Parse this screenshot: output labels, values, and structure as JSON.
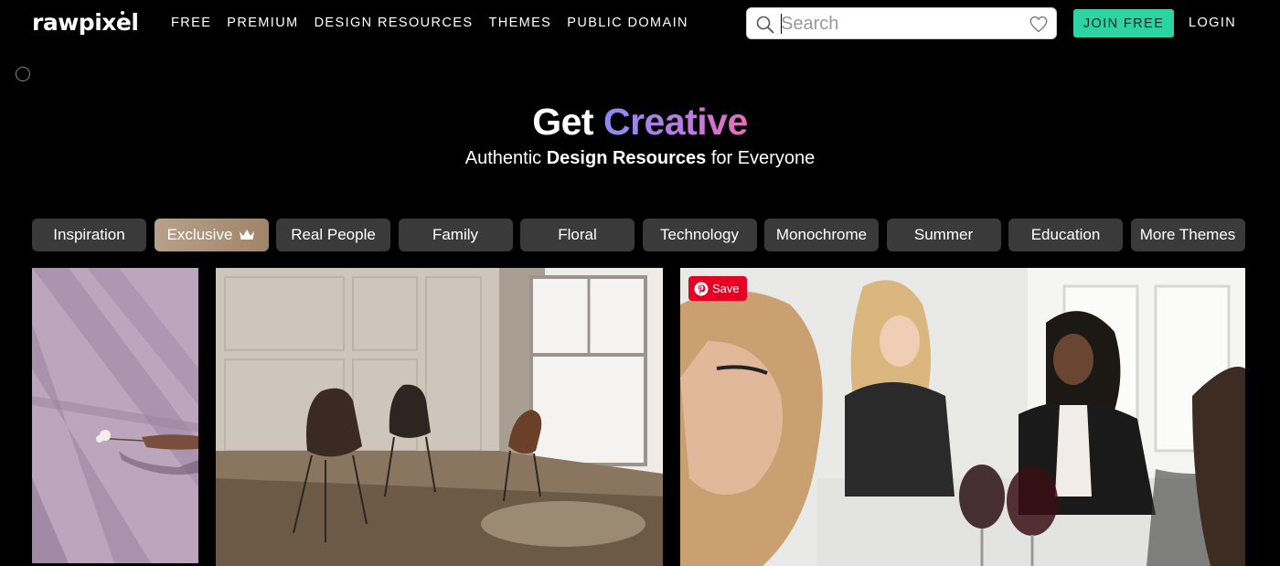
{
  "header": {
    "logo": "rawpixel",
    "nav": [
      "FREE",
      "PREMIUM",
      "DESIGN RESOURCES",
      "THEMES",
      "PUBLIC DOMAIN"
    ],
    "search_placeholder": "Search",
    "join_label": "JOIN FREE",
    "login_label": "LOGIN"
  },
  "hero": {
    "title_plain": "Get",
    "title_highlight": "Creative",
    "sub_pre": "Authentic",
    "sub_bold": "Design Resources",
    "sub_post": "for Everyone"
  },
  "themes": [
    "Inspiration",
    "Exclusive",
    "Real People",
    "Family",
    "Floral",
    "Technology",
    "Monochrome",
    "Summer",
    "Education",
    "More Themes"
  ],
  "save_badge": "Save",
  "icons": [
    "search-icon",
    "heart-icon",
    "crown-icon",
    "pinterest-icon"
  ],
  "colors": {
    "background": "#000000",
    "accent": "#2ed3a3",
    "pill": "#3a3a3a",
    "pinterest": "#e60023"
  }
}
